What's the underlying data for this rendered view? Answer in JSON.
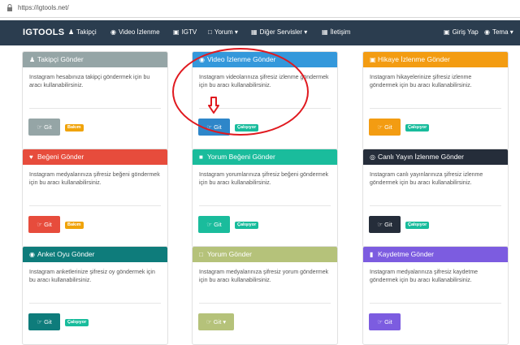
{
  "browser": {
    "url": "https://igtools.net/"
  },
  "navbar": {
    "brand": "IGTOOLS",
    "items": [
      {
        "label": "Takipçi"
      },
      {
        "label": "Video İzlenme"
      },
      {
        "label": "IGTV"
      },
      {
        "label": "Yorum"
      },
      {
        "label": "Diğer Servisler"
      },
      {
        "label": "İletişim"
      }
    ],
    "right": [
      {
        "label": "Giriş Yap"
      },
      {
        "label": "Tema"
      }
    ]
  },
  "cards": [
    {
      "title": "Takipçi Gönder",
      "desc": "Instagram hesabınıza takipçi göndermek için bu aracı kullanabilirsiniz.",
      "button": "Git",
      "status": "Bakım",
      "color": "#95a5a6",
      "btn_color": "#95a5a6"
    },
    {
      "title": "Video İzlenme Gönder",
      "desc": "Instagram videolarınıza şifresiz izlenme göndermek için bu aracı kullanabilirsiniz.",
      "button": "Git",
      "status": "Çalışıyor",
      "color": "#3498db",
      "btn_color": "#2e86c9"
    },
    {
      "title": "Hikaye İzlenme Gönder",
      "desc": "Instagram hikayelerinize şifresiz izlenme göndermek için bu aracı kullanabilirsiniz.",
      "button": "Git",
      "status": "Çalışıyor",
      "color": "#f39c12",
      "btn_color": "#f39c12"
    },
    {
      "title": "Beğeni Gönder",
      "desc": "Instagram medyalarınıza şifresiz beğeni göndermek için bu aracı kullanabilirsiniz.",
      "button": "Git",
      "status": "Bakım",
      "color": "#e74c3c",
      "btn_color": "#e74c3c"
    },
    {
      "title": "Yorum Beğeni Gönder",
      "desc": "Instagram yorumlarınıza şifresiz beğeni göndermek için bu aracı kullanabilirsiniz.",
      "button": "Git",
      "status": "Çalışıyor",
      "color": "#1abc9c",
      "btn_color": "#1abc9c"
    },
    {
      "title": "Canlı Yayın İzlenme Gönder",
      "desc": "Instagram canlı yayınlarınıza şifresiz izlenme göndermek için bu aracı kullanabilirsiniz.",
      "button": "Git",
      "status": "Çalışıyor",
      "color": "#252d3a",
      "btn_color": "#252d3a"
    },
    {
      "title": "Anket Oyu Gönder",
      "desc": "Instagram anketlerinize şifresiz oy göndermek için bu aracı kullanabilirsiniz.",
      "button": "Git",
      "status": "Çalışıyor",
      "color": "#0e7c7b",
      "btn_color": "#0e7c7b"
    },
    {
      "title": "Yorum Gönder",
      "desc": "Instagram medyalarınıza şifresiz yorum göndermek için bu aracı kullanabilirsiniz.",
      "button": "Git",
      "status": "",
      "color": "#b5c27a",
      "btn_color": "#b5c27a"
    },
    {
      "title": "Kaydetme Gönder",
      "desc": "Instagram medyalarınıza şifresiz kaydetme göndermek için bu aracı kullanabilirsiniz.",
      "button": "Git",
      "status": "",
      "color": "#7c5ce0",
      "btn_color": "#7c5ce0"
    }
  ]
}
